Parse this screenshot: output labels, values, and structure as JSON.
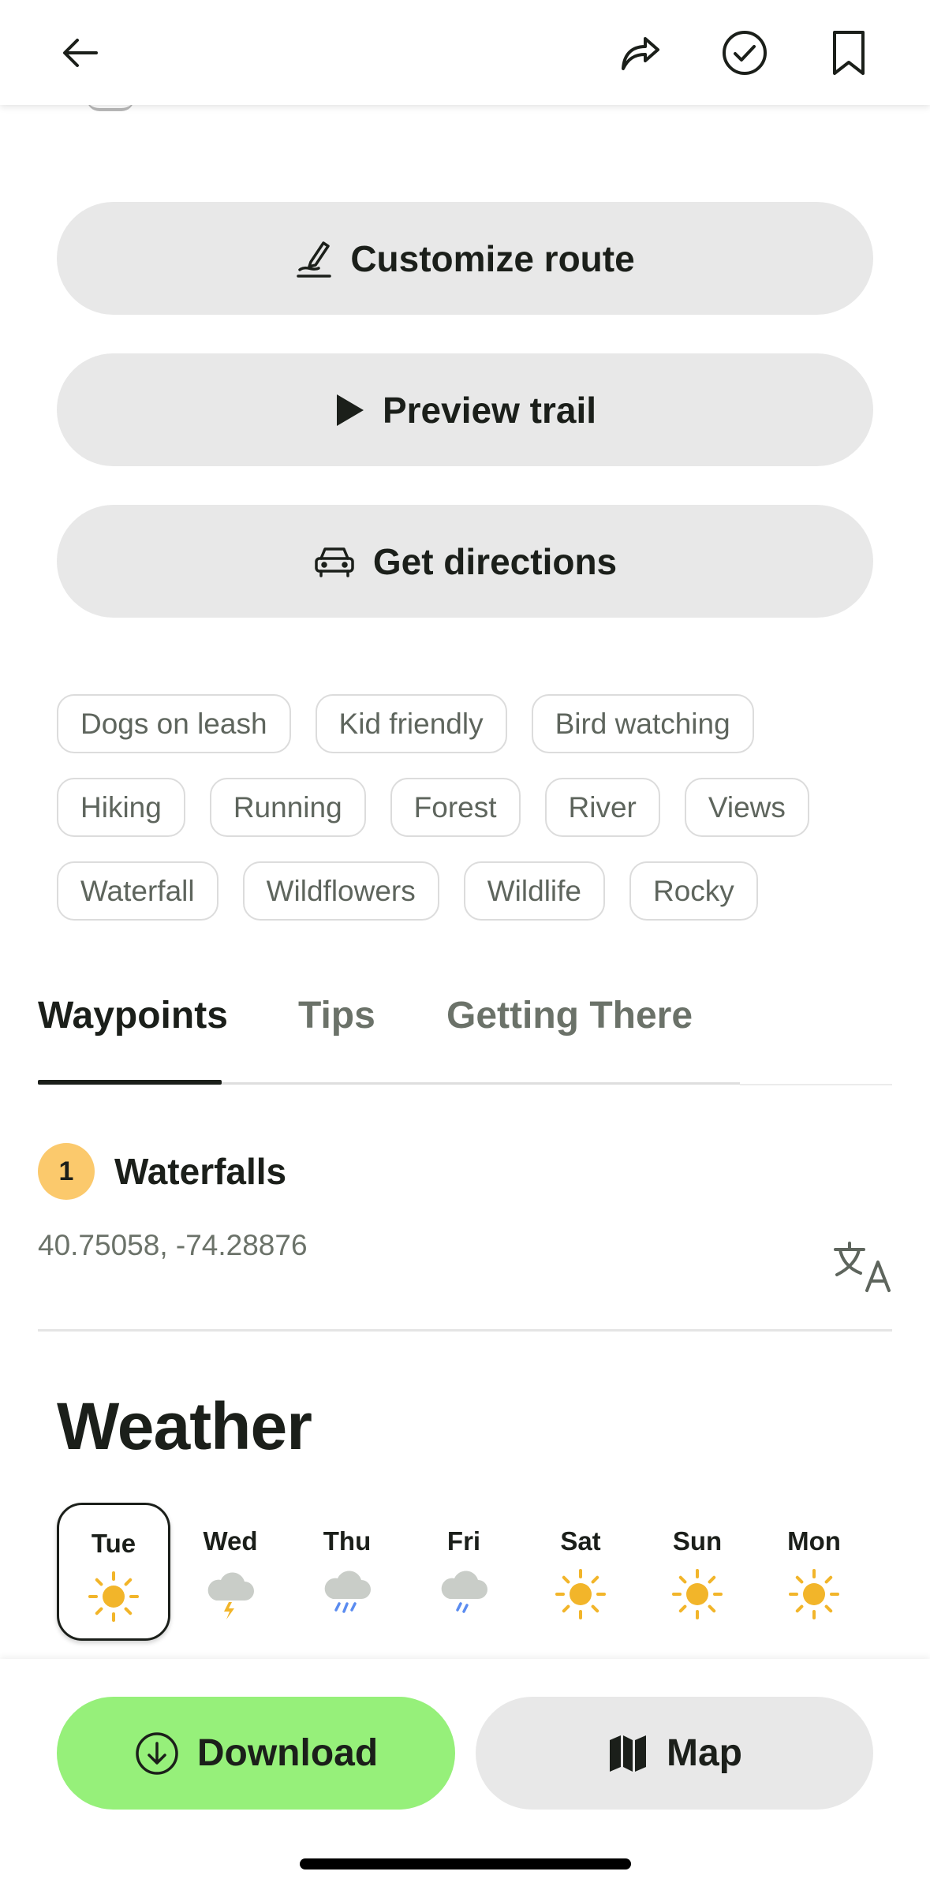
{
  "actions": {
    "customize_label": "Customize route",
    "preview_label": "Preview trail",
    "directions_label": "Get directions"
  },
  "tags": [
    [
      "Dogs on leash",
      "Kid friendly",
      "Bird watching"
    ],
    [
      "Hiking",
      "Running",
      "Forest",
      "River",
      "Views"
    ],
    [
      "Waterfall",
      "Wildflowers",
      "Wildlife",
      "Rocky"
    ]
  ],
  "tabs": {
    "waypoints": "Waypoints",
    "tips": "Tips",
    "getting_there": "Getting There",
    "active": "waypoints"
  },
  "waypoint": {
    "number": "1",
    "title": "Waterfalls",
    "coords": "40.75058, -74.28876"
  },
  "weather": {
    "title": "Weather",
    "days": [
      {
        "name": "Tue",
        "icon": "sun-icon",
        "selected": true
      },
      {
        "name": "Wed",
        "icon": "thunderstorm-icon",
        "selected": false
      },
      {
        "name": "Thu",
        "icon": "heavy-rain-icon",
        "selected": false
      },
      {
        "name": "Fri",
        "icon": "light-rain-icon",
        "selected": false
      },
      {
        "name": "Sat",
        "icon": "sun-icon",
        "selected": false
      },
      {
        "name": "Sun",
        "icon": "sun-icon",
        "selected": false
      },
      {
        "name": "Mon",
        "icon": "sun-icon",
        "selected": false
      }
    ]
  },
  "bottom": {
    "download_label": "Download",
    "map_label": "Map"
  },
  "colors": {
    "accent_green": "#96f07a",
    "badge_yellow": "#fbc96c",
    "sun": "#f2b52a",
    "rain": "#5b8cf0"
  }
}
